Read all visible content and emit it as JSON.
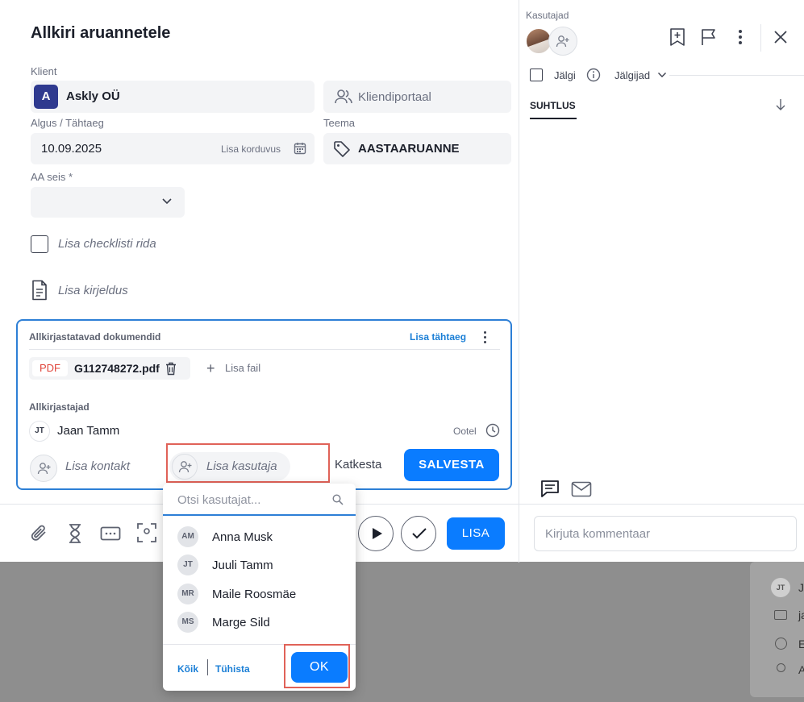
{
  "modal": {
    "title": "Allkiri aruannetele",
    "client_label": "Klient",
    "client_initial": "A",
    "client_name": "Askly OÜ",
    "portal_label": "Kliendiportaal",
    "dates_label": "Algus / Tähtaeg",
    "date_value": "10.09.2025",
    "recurrence_label": "Lisa korduvus",
    "topic_label": "Teema",
    "topic_value": "AASTAARUANNE",
    "status_label": "AA seis *",
    "checklist_placeholder": "Lisa checklisti rida",
    "description_placeholder": "Lisa kirjeldus"
  },
  "documents": {
    "section_title": "Allkirjastatavad dokumendid",
    "add_deadline": "Lisa tähtaeg",
    "file_type": "PDF",
    "file_name": "G112748272.pdf",
    "add_file": "Lisa fail",
    "signers_label": "Allkirjastajad",
    "signer_initials": "JT",
    "signer_name": "Jaan Tamm",
    "signer_status": "Ootel",
    "add_contact": "Lisa kontakt",
    "add_user": "Lisa kasutaja",
    "cancel": "Katkesta",
    "save": "SALVESTA"
  },
  "toolbar": {
    "add": "LISA",
    "comment_placeholder": "Kirjuta kommentaar"
  },
  "right_panel": {
    "users_label": "Kasutajad",
    "follow_label": "Jälgi",
    "followers_label": "Jälgijad",
    "tab_communication": "SUHTLUS"
  },
  "user_dropdown": {
    "search_placeholder": "Otsi kasutajat...",
    "users": [
      {
        "initials": "AM",
        "name": "Anna Musk"
      },
      {
        "initials": "JT",
        "name": "Juuli Tamm"
      },
      {
        "initials": "MR",
        "name": "Maile Roosmäe"
      },
      {
        "initials": "MS",
        "name": "Marge Sild"
      }
    ],
    "select_all": "Kõik",
    "clear": "Tühista",
    "ok": "OK"
  },
  "background": {
    "initials": "JT",
    "row1": "J",
    "row2": "ja",
    "row3": "E",
    "row4": "A"
  },
  "colors": {
    "accent": "#0a7cff",
    "border_focus": "#2d7fd6",
    "highlight": "#e06258",
    "pdf_red": "#e0443a"
  }
}
